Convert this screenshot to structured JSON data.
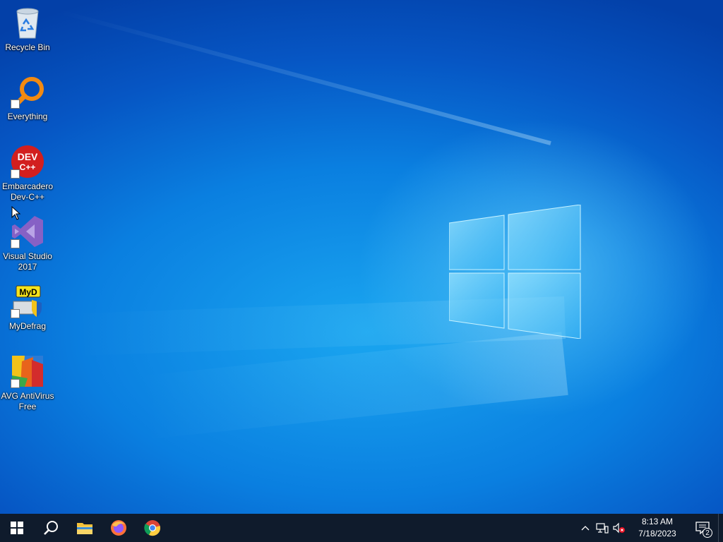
{
  "desktop": {
    "icons": [
      {
        "label": "Recycle Bin"
      },
      {
        "label": "Everything"
      },
      {
        "label": "Embarcadero Dev-C++"
      },
      {
        "label": "Visual Studio 2017"
      },
      {
        "label": "MyDefrag"
      },
      {
        "label": "AVG AntiVirus Free"
      }
    ],
    "devcpp_logo_text": "DEV C++",
    "mydefrag_logo_text": "MyD"
  },
  "taskbar": {
    "pinned": [
      "start-icon",
      "search-icon",
      "file-explorer-icon",
      "firefox-icon",
      "chrome-icon"
    ],
    "clock": {
      "time": "8:13 AM",
      "date": "7/18/2023"
    },
    "notification_count": "2"
  },
  "colors": {
    "taskbar_bg": "#0f1b2c",
    "wallpaper_accent": "#0a7fe0"
  }
}
